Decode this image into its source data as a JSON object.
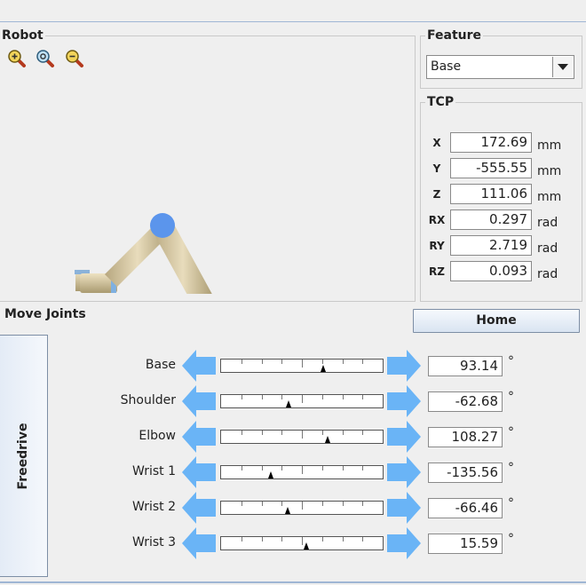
{
  "robot": {
    "title": "Robot",
    "zoom_icons": [
      "zoom-in-icon",
      "zoom-reset-icon",
      "zoom-out-icon"
    ]
  },
  "feature": {
    "title": "Feature",
    "selected": "Base"
  },
  "tcp": {
    "title": "TCP",
    "rows": [
      {
        "label": "X",
        "value": "172.69",
        "unit": "mm"
      },
      {
        "label": "Y",
        "value": "-555.55",
        "unit": "mm"
      },
      {
        "label": "Z",
        "value": "111.06",
        "unit": "mm"
      },
      {
        "label": "RX",
        "value": "0.297",
        "unit": "rad"
      },
      {
        "label": "RY",
        "value": "2.719",
        "unit": "rad"
      },
      {
        "label": "RZ",
        "value": "0.093",
        "unit": "rad"
      }
    ]
  },
  "move_joints": {
    "title": "Move Joints",
    "home_label": "Home",
    "freedrive_label": "Freedrive",
    "joints": [
      {
        "label": "Base",
        "value": "93.14",
        "unit": "°",
        "position": 0.63
      },
      {
        "label": "Shoulder",
        "value": "-62.68",
        "unit": "°",
        "position": 0.42
      },
      {
        "label": "Elbow",
        "value": "108.27",
        "unit": "°",
        "position": 0.66
      },
      {
        "label": "Wrist 1",
        "value": "-135.56",
        "unit": "°",
        "position": 0.31
      },
      {
        "label": "Wrist 2",
        "value": "-66.46",
        "unit": "°",
        "position": 0.41
      },
      {
        "label": "Wrist 3",
        "value": "15.59",
        "unit": "°",
        "position": 0.53
      }
    ]
  },
  "colors": {
    "accent_blue": "#6ab4f6",
    "arm_beige": "#d6c9a6",
    "joint_blue": "#5b95ec"
  }
}
